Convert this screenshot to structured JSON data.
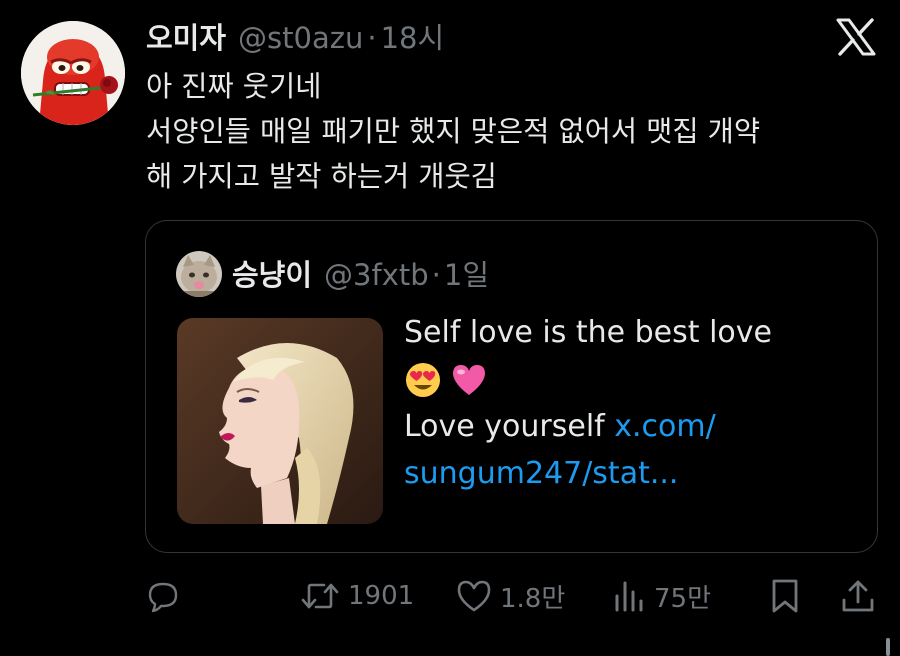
{
  "tweet": {
    "display_name": "오미자",
    "handle": "@st0azu",
    "separator": "·",
    "time": "18시",
    "text_lines": [
      "아 진짜 웃기네",
      "서양인들 매일 패기만 했지 맞은적 없어서 맷집 개약",
      "해 가지고 발작 하는거 개웃김"
    ]
  },
  "quote": {
    "display_name": "승냥이",
    "handle": "@3fxtb",
    "separator": "·",
    "time": "1일",
    "text_line1": "Self love is the best love",
    "emojis": [
      "😍",
      "💗"
    ],
    "text_line3_prefix": "Love yourself ",
    "link_part1": "x.com/",
    "link_part2": "sungum247/stat..."
  },
  "actions": {
    "reply_count": "",
    "retweet_count": "1901",
    "like_count": "1.8만",
    "views_count": "75만"
  },
  "icons": {
    "brand": "x-logo-icon",
    "reply": "reply-icon",
    "retweet": "retweet-icon",
    "like": "heart-icon",
    "views": "views-icon",
    "bookmark": "bookmark-icon",
    "share": "share-icon"
  },
  "colors": {
    "background": "#000000",
    "text_primary": "#e7e9ea",
    "text_secondary": "#71767b",
    "link": "#1d9bf0",
    "border": "#333639"
  }
}
